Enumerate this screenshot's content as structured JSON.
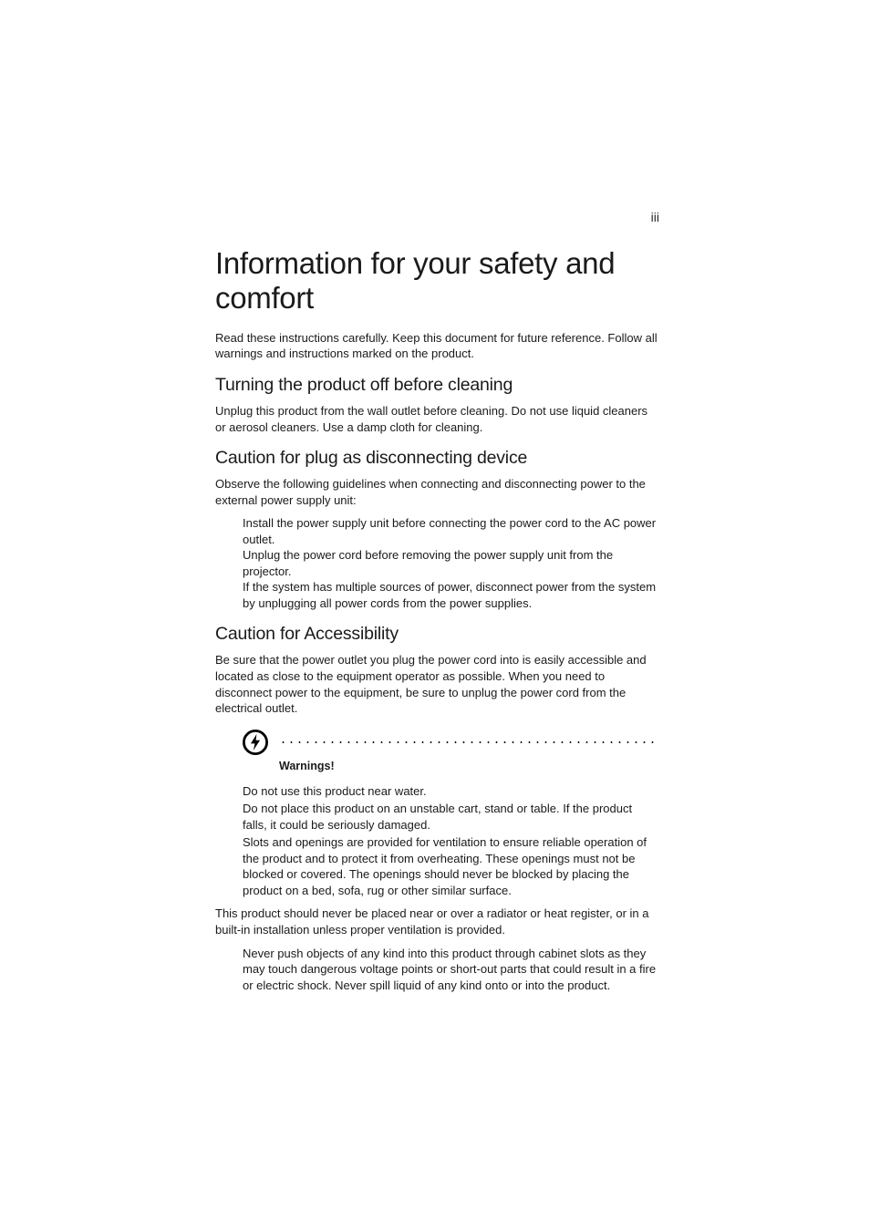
{
  "pageNumber": "iii",
  "title": "Information for your safety and comfort",
  "intro": "Read these instructions carefully. Keep this document for future reference. Follow all warnings and instructions marked on the product.",
  "section1": {
    "heading": "Turning the product off before cleaning",
    "body": "Unplug this product from the wall outlet before cleaning. Do not use liquid cleaners or aerosol cleaners. Use a damp cloth for cleaning."
  },
  "section2": {
    "heading": "Caution for plug as disconnecting device",
    "body": "Observe the following guidelines when connecting and disconnecting power to the external power supply unit:",
    "items": [
      "Install the power supply unit before connecting the power cord to the AC power outlet.",
      "Unplug the power cord before removing the power supply unit from the projector.",
      "If the system has multiple sources of power, disconnect power from the system by unplugging all power cords from the power supplies."
    ]
  },
  "section3": {
    "heading": "Caution for Accessibility",
    "body": "Be sure that the power outlet you plug the power cord into is easily accessible and located as close to the equipment operator as possible. When you need to disconnect power to the equipment, be sure to unplug the power cord from the electrical outlet."
  },
  "warnings": {
    "label": "Warnings!",
    "items1": [
      "Do not use this product near water.",
      "Do not place this product on an unstable cart, stand or table. If the product falls, it could be seriously damaged.",
      "Slots and openings are provided for ventilation to ensure reliable operation of the product and to protect it from overheating. These openings must not be blocked or covered. The openings should never be blocked by placing the product on a bed, sofa, rug or other similar surface."
    ],
    "mid": "This product should never be placed near or over a radiator or heat register, or in a built-in installation unless proper ventilation is provided.",
    "items2": [
      "Never push objects of any kind into this product through cabinet slots as they may touch dangerous voltage points or short-out parts that could result in a fire or electric shock. Never spill liquid of any kind onto or into the product."
    ]
  }
}
